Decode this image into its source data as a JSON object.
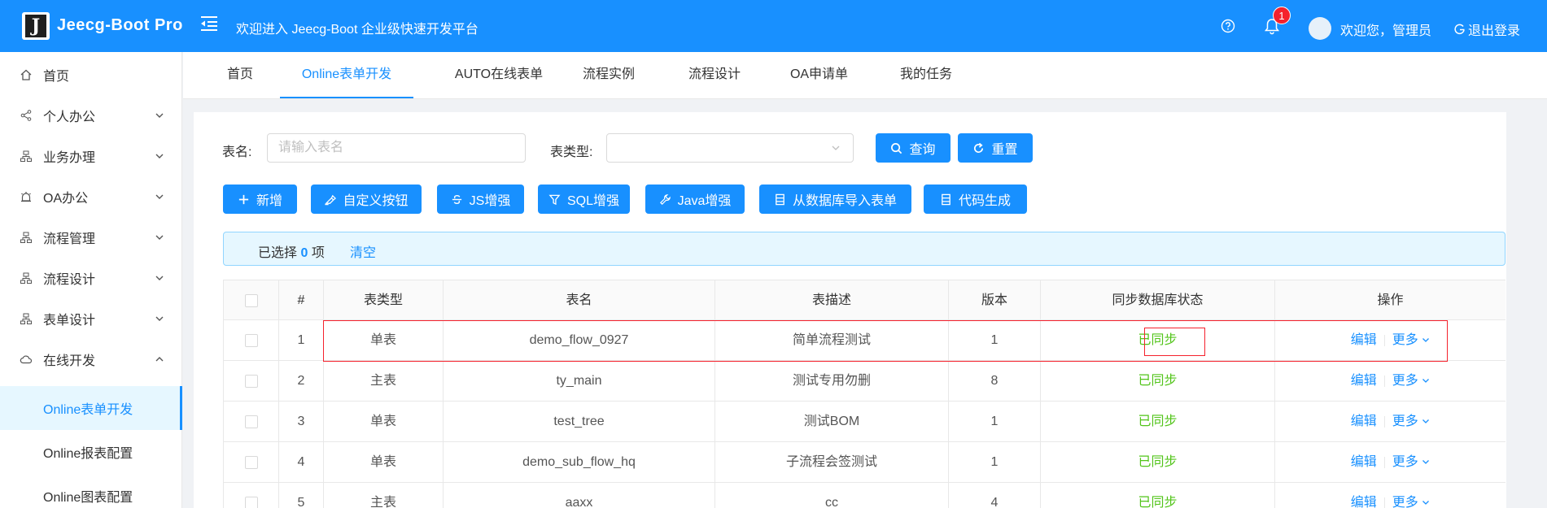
{
  "header": {
    "logo_letter": "J",
    "app_title": "Jeecg-Boot Pro",
    "platform_welcome": "欢迎进入 Jeecg-Boot 企业级快速开发平台",
    "notification_count": "1",
    "user_welcome": "欢迎您，管理员",
    "logout_label": "退出登录",
    "menu_toggle_icon": "menu-fold-icon",
    "help_icon": "question-circle-icon",
    "bell_icon": "bell-icon"
  },
  "sidebar": {
    "items": [
      {
        "label": "首页",
        "icon": "home-icon",
        "expanded": null
      },
      {
        "label": "个人办公",
        "icon": "share-icon",
        "expanded": false
      },
      {
        "label": "业务办理",
        "icon": "cluster-icon",
        "expanded": false
      },
      {
        "label": "OA办公",
        "icon": "alarm-icon",
        "expanded": false
      },
      {
        "label": "流程管理",
        "icon": "cluster-icon",
        "expanded": false
      },
      {
        "label": "流程设计",
        "icon": "cluster-icon",
        "expanded": false
      },
      {
        "label": "表单设计",
        "icon": "cluster-icon",
        "expanded": false
      },
      {
        "label": "在线开发",
        "icon": "cloud-icon",
        "expanded": true
      }
    ],
    "subitems": [
      {
        "label": "Online表单开发",
        "active": true
      },
      {
        "label": "Online报表配置",
        "active": false
      },
      {
        "label": "Online图表配置",
        "active": false
      }
    ]
  },
  "tabs": [
    {
      "label": "首页",
      "active": false
    },
    {
      "label": "Online表单开发",
      "active": true
    },
    {
      "label": "AUTO在线表单",
      "active": false
    },
    {
      "label": "流程实例",
      "active": false
    },
    {
      "label": "流程设计",
      "active": false
    },
    {
      "label": "OA申请单",
      "active": false
    },
    {
      "label": "我的任务",
      "active": false
    }
  ],
  "search": {
    "table_name_label": "表名:",
    "table_name_placeholder": "请输入表名",
    "table_type_label": "表类型:",
    "table_type_value": "",
    "query_label": "查询",
    "reset_label": "重置"
  },
  "toolbar": {
    "add_label": "新增",
    "custom_button_label": "自定义按钮",
    "js_enhance_label": "JS增强",
    "sql_enhance_label": "SQL增强",
    "java_enhance_label": "Java增强",
    "import_from_db_label": "从数据库导入表单",
    "code_gen_label": "代码生成"
  },
  "selection_alert": {
    "prefix": "已选择",
    "count": "0",
    "suffix": "项",
    "clear_label": "清空"
  },
  "table": {
    "headers": [
      "#",
      "表类型",
      "表名",
      "表描述",
      "版本",
      "同步数据库状态",
      "操作"
    ],
    "rows": [
      {
        "index": "1",
        "type": "单表",
        "name": "demo_flow_0927",
        "desc": "简单流程测试",
        "version": "1",
        "sync": "已同步",
        "edit": "编辑",
        "more": "更多"
      },
      {
        "index": "2",
        "type": "主表",
        "name": "ty_main",
        "desc": "测试专用勿删",
        "version": "8",
        "sync": "已同步",
        "edit": "编辑",
        "more": "更多"
      },
      {
        "index": "3",
        "type": "单表",
        "name": "test_tree",
        "desc": "测试BOM",
        "version": "1",
        "sync": "已同步",
        "edit": "编辑",
        "more": "更多"
      },
      {
        "index": "4",
        "type": "单表",
        "name": "demo_sub_flow_hq",
        "desc": "子流程会签测试",
        "version": "1",
        "sync": "已同步",
        "edit": "编辑",
        "more": "更多"
      },
      {
        "index": "5",
        "type": "主表",
        "name": "aaxx",
        "desc": "cc",
        "version": "4",
        "sync": "已同步",
        "edit": "编辑",
        "more": "更多"
      }
    ]
  },
  "colors": {
    "primary": "#1890ff",
    "success": "#52c41a",
    "highlight": "#f5222d"
  }
}
